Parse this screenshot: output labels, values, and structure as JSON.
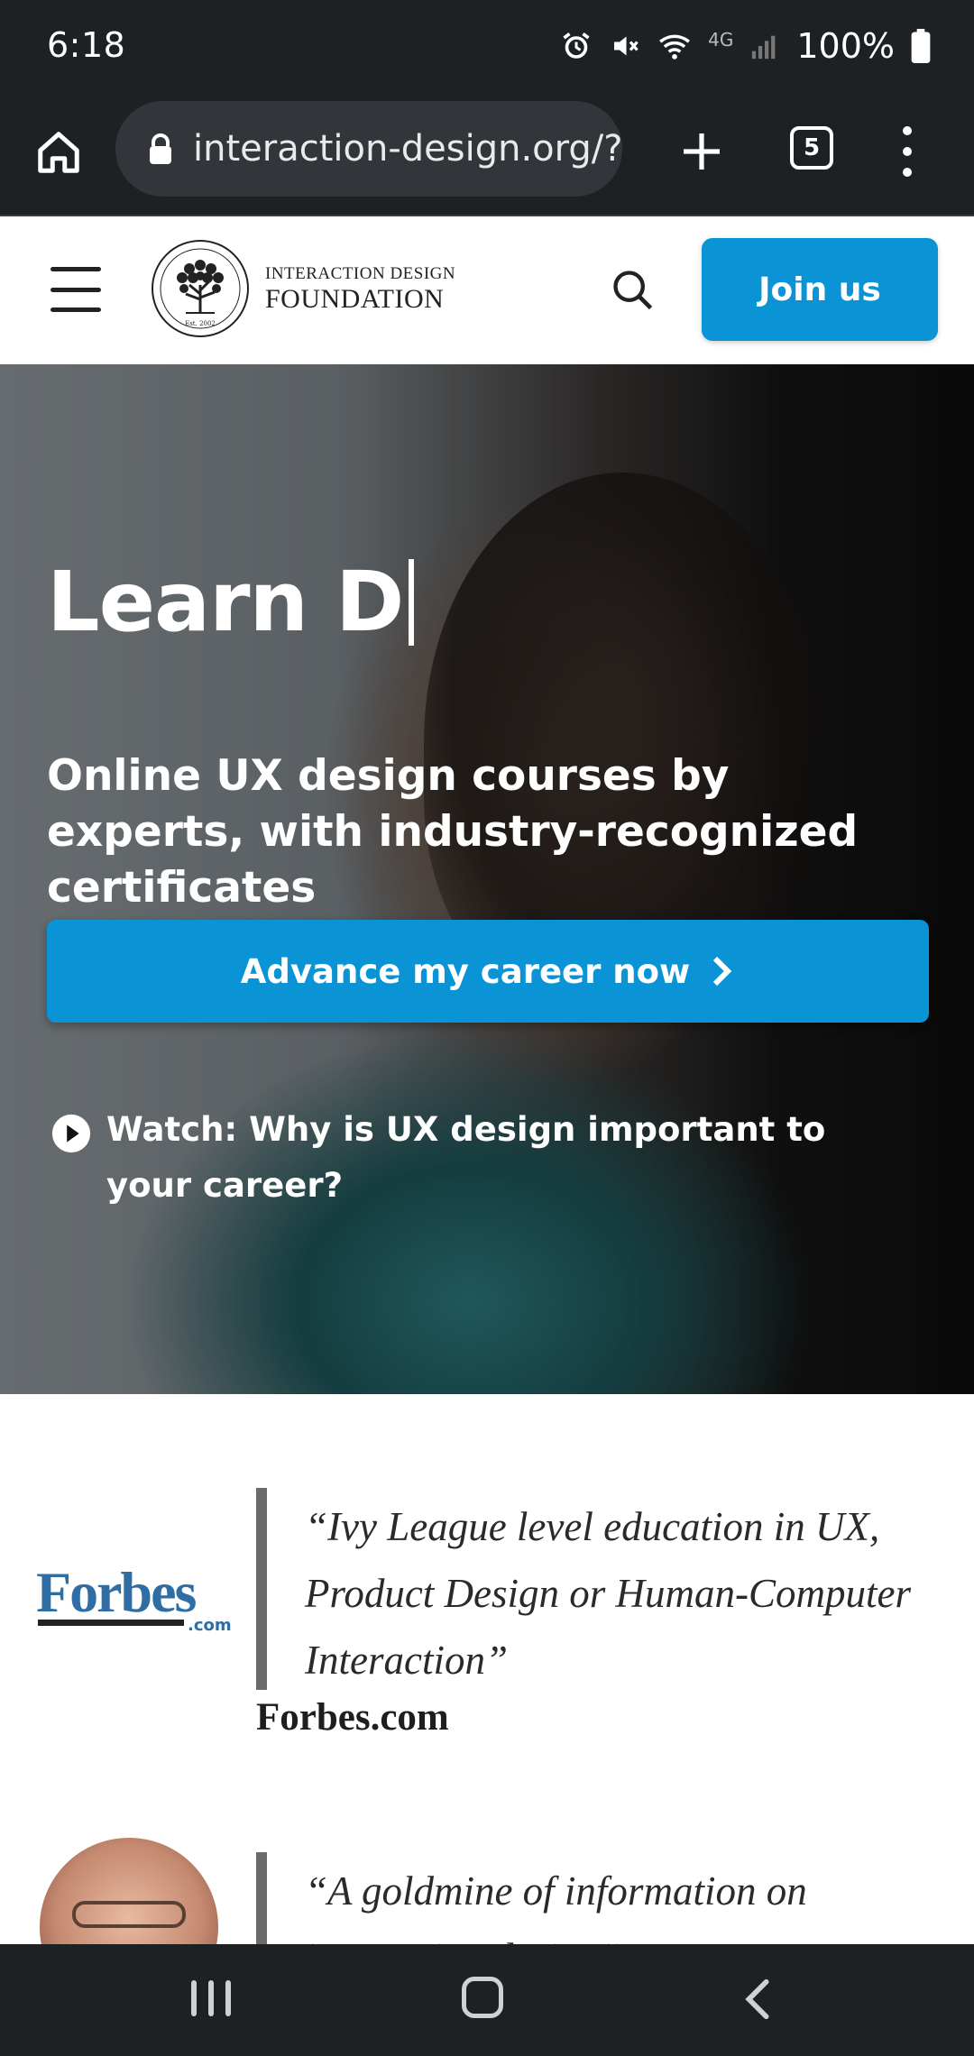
{
  "status_bar": {
    "time": "6:18",
    "network": "4G",
    "battery": "100%",
    "icons": [
      "alarm-icon",
      "mute-icon",
      "wifi-icon",
      "signal-icon",
      "battery-icon"
    ]
  },
  "browser": {
    "url": "interaction-design.org/?u",
    "tab_count": "5",
    "icons": [
      "home-icon",
      "lock-icon",
      "plus-icon",
      "tabs-icon",
      "more-vert-icon"
    ]
  },
  "header": {
    "logo_line1": "INTERACTION DESIGN",
    "logo_line2": "FOUNDATION",
    "logo_emblem_text_top": "INTERACTION DESIGN FOUNDATION",
    "logo_emblem_text_bottom": "Est. 2002",
    "join_label": "Join us",
    "icons": [
      "menu-icon",
      "search-icon"
    ]
  },
  "hero": {
    "title": "Learn D",
    "subtitle": "Online UX design courses by experts, with industry-recognized certificates",
    "cta_label": "Advance my career now",
    "watch_label": "Watch: Why is UX design important to your career?"
  },
  "testimonials": [
    {
      "logo_text": "Forbes",
      "logo_sub": ".com",
      "quote": "“Ivy League level education in UX, Product Design or Human-Computer Interaction”",
      "source": "Forbes.com"
    },
    {
      "quote": "“A goldmine of information on interaction design”"
    }
  ],
  "colors": {
    "accent": "#0a94d6",
    "chrome": "#1e2124",
    "forbes_blue": "#2f6ea4"
  }
}
